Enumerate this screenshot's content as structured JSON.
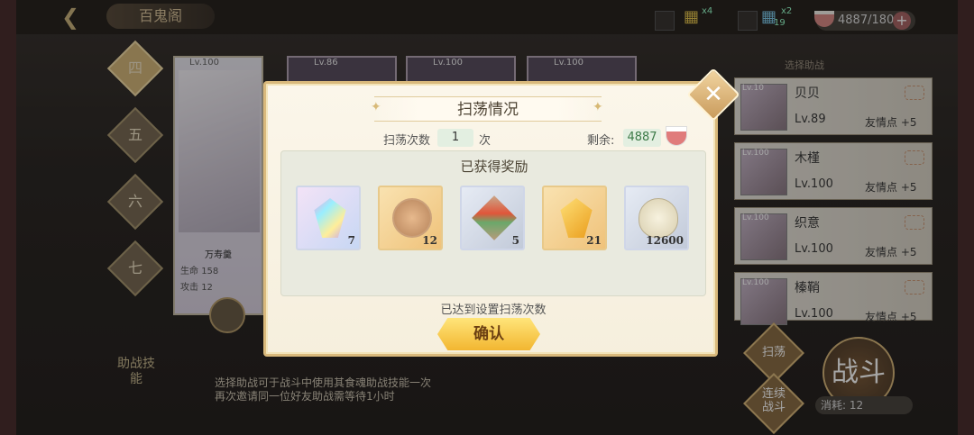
{
  "topbar": {
    "title": "百鬼阁",
    "res1_count": "x4",
    "res2_count": "x2",
    "res2_extra": "19",
    "stamina": "4887/180"
  },
  "floors": [
    "四",
    "五",
    "六",
    "七"
  ],
  "hero": {
    "lv": "Lv.100",
    "name": "万寿羹",
    "hp_label": "生命",
    "hp_val": "158",
    "atk_label": "攻击",
    "atk_val": "12"
  },
  "other_cards": [
    "Lv.86",
    "Lv.100",
    "Lv.100"
  ],
  "help": {
    "label": "助战技能",
    "text1": "选择助战可于战斗中使用其食魂助战技能一次",
    "text2": "再次邀请同一位好友助战需等待1小时"
  },
  "assist": {
    "title": "选择助战",
    "friends": [
      {
        "avatar_lv": "Lv.10",
        "name": "贝贝",
        "lv": "Lv.89",
        "points": "友情点 +5"
      },
      {
        "avatar_lv": "Lv.100",
        "name": "木槿",
        "lv": "Lv.100",
        "points": "友情点 +5"
      },
      {
        "avatar_lv": "Lv.100",
        "name": "织意",
        "lv": "Lv.100",
        "points": "友情点 +5"
      },
      {
        "avatar_lv": "Lv.100",
        "name": "榛鞘",
        "lv": "Lv.100",
        "points": "友情点 +5"
      }
    ]
  },
  "buttons": {
    "sweep": "扫荡",
    "continuous": "连续战斗",
    "fight": "战斗",
    "cost_label": "消耗:",
    "cost_val": "12"
  },
  "modal": {
    "title": "扫荡情况",
    "sweep_label": "扫荡次数",
    "sweep_count": "1",
    "sweep_unit": "次",
    "remain_label": "剩余:",
    "remain_val": "4887",
    "rewards_title": "已获得奖励",
    "items": [
      {
        "icon": "rainbow-crystal-icon",
        "qty": "7"
      },
      {
        "icon": "coin-icon",
        "qty": "12"
      },
      {
        "icon": "carpet-icon",
        "qty": "5"
      },
      {
        "icon": "gold-crystal-icon",
        "qty": "21"
      },
      {
        "icon": "cowrie-shell-icon",
        "qty": "12600"
      }
    ],
    "done_text": "已达到设置扫荡次数",
    "confirm": "确认"
  }
}
